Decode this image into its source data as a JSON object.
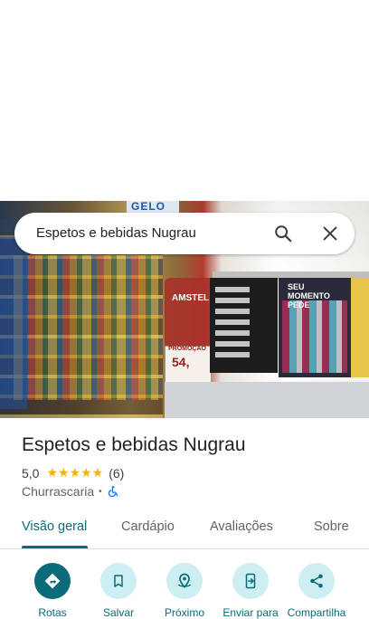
{
  "search": {
    "query": "Espetos e bebidas Nugrau"
  },
  "photo": {
    "sign_text": "GELO",
    "promo_label": "PROMOÇÃO",
    "promo_price": "54,",
    "amstel_text": "AMSTEL",
    "poster_text": "SEU MOMENTO PEDE"
  },
  "place": {
    "name": "Espetos e bebidas Nugrau",
    "rating": "5,0",
    "stars": "★★★★★",
    "reviews": "(6)",
    "category": "Churrascaria",
    "separator": "•"
  },
  "tabs": [
    {
      "label": "Visão geral",
      "active": true
    },
    {
      "label": "Cardápio"
    },
    {
      "label": "Avaliações"
    },
    {
      "label": "Sobre"
    }
  ],
  "actions": [
    {
      "label": "Rotas",
      "icon": "directions-icon"
    },
    {
      "label": "Salvar",
      "icon": "bookmark-icon"
    },
    {
      "label": "Próximo",
      "icon": "nearby-icon"
    },
    {
      "label": "Enviar para",
      "icon": "send-to-phone-icon"
    },
    {
      "label": "Compartilha",
      "icon": "share-icon"
    }
  ],
  "colors": {
    "accent": "#0b6b78",
    "accent_light": "#cdeef3",
    "star": "#f4b400"
  }
}
